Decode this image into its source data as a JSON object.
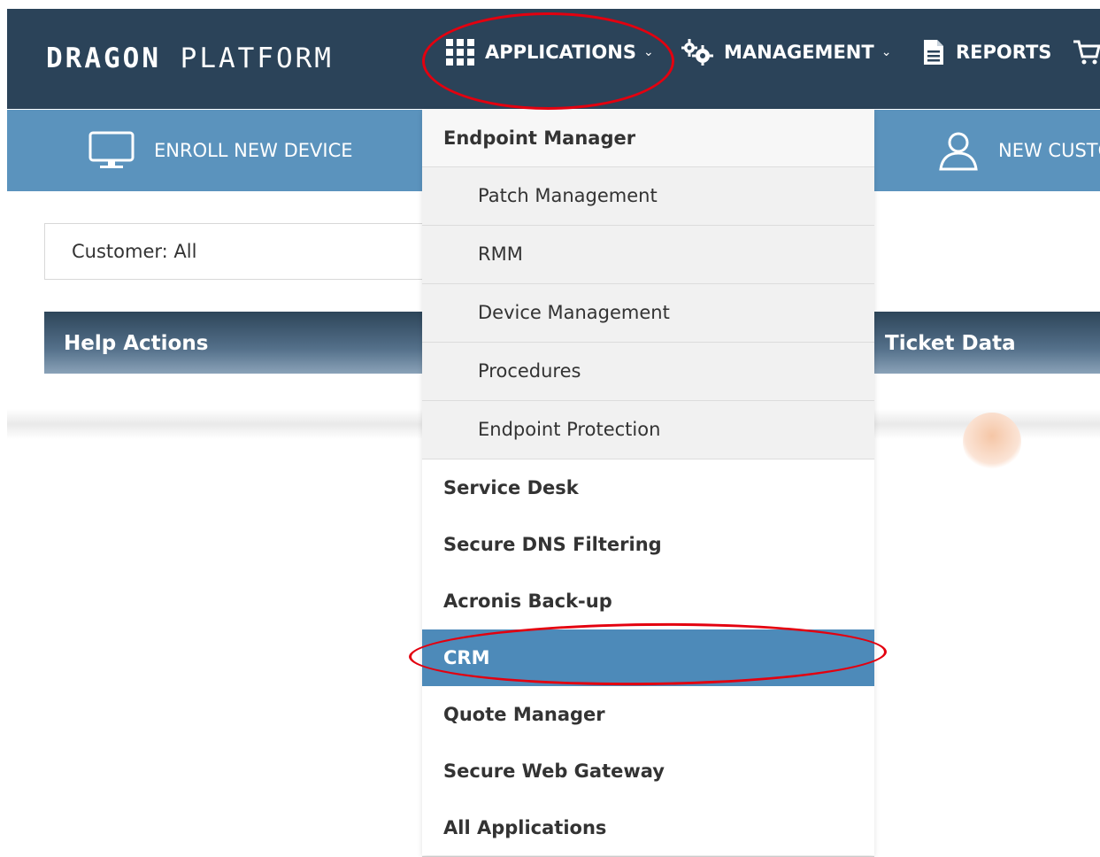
{
  "brand": {
    "bold": "DRAGON",
    "light": "PLATFORM"
  },
  "nav": {
    "applications": {
      "label": "APPLICATIONS",
      "icon": "grid-icon"
    },
    "management": {
      "label": "MANAGEMENT",
      "icon": "gears-icon"
    },
    "reports": {
      "label": "REPORTS",
      "icon": "document-icon"
    },
    "cart": {
      "icon": "cart-icon"
    }
  },
  "actions": {
    "enroll": {
      "label": "ENROLL NEW DEVICE",
      "icon": "monitor-icon"
    },
    "new_customer": {
      "label": "NEW CUSTO",
      "icon": "user-icon"
    }
  },
  "filter": {
    "customer": "Customer: All"
  },
  "widgets": {
    "help_actions": "Help Actions",
    "ticket_data": "Ticket Data"
  },
  "dropdown": {
    "header": "Endpoint Manager",
    "sub_items": [
      "Patch Management",
      "RMM",
      "Device Management",
      "Procedures",
      "Endpoint Protection"
    ],
    "items": [
      "Service Desk",
      "Secure DNS Filtering",
      "Acronis Back-up",
      "CRM",
      "Quote Manager",
      "Secure Web Gateway",
      "All Applications"
    ],
    "active_item": "CRM"
  },
  "colors": {
    "topbar": "#2b4359",
    "actionbar": "#5b93bd",
    "active": "#4d8ab9",
    "annotation": "#e3000f"
  }
}
